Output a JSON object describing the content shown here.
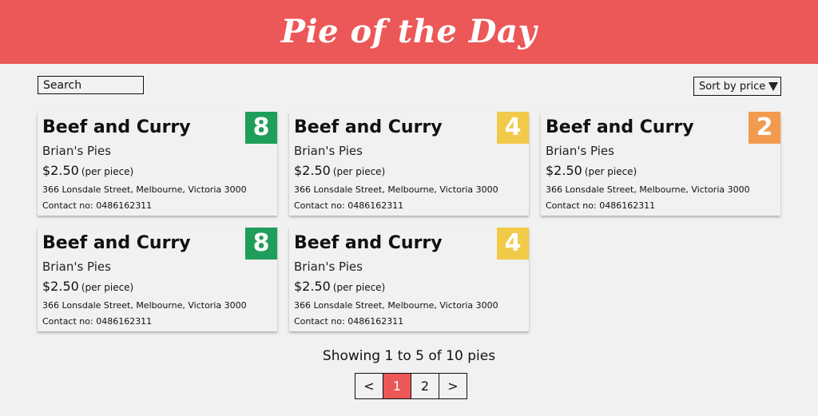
{
  "header": {
    "title": "Pie of the Day"
  },
  "search": {
    "placeholder": "Search"
  },
  "sort": {
    "label": "Sort by price"
  },
  "pies": [
    {
      "name": "Beef and Curry",
      "shop": "Brian's Pies",
      "price": "$2.50",
      "unit": "(per piece)",
      "address": "366 Lonsdale Street, Melbourne, Victoria 3000",
      "contact": "Contact no: 0486162311",
      "rating": "8",
      "rating_color": "#1e9e5a"
    },
    {
      "name": "Beef and Curry",
      "shop": "Brian's Pies",
      "price": "$2.50",
      "unit": "(per piece)",
      "address": "366 Lonsdale Street, Melbourne, Victoria 3000",
      "contact": "Contact no: 0486162311",
      "rating": "4",
      "rating_color": "#f2ca4a"
    },
    {
      "name": "Beef and Curry",
      "shop": "Brian's Pies",
      "price": "$2.50",
      "unit": "(per piece)",
      "address": "366 Lonsdale Street, Melbourne, Victoria 3000",
      "contact": "Contact no: 0486162311",
      "rating": "2",
      "rating_color": "#f29b4e"
    },
    {
      "name": "Beef and Curry",
      "shop": "Brian's Pies",
      "price": "$2.50",
      "unit": "(per piece)",
      "address": "366 Lonsdale Street, Melbourne, Victoria 3000",
      "contact": "Contact no: 0486162311",
      "rating": "8",
      "rating_color": "#1e9e5a"
    },
    {
      "name": "Beef and Curry",
      "shop": "Brian's Pies",
      "price": "$2.50",
      "unit": "(per piece)",
      "address": "366 Lonsdale Street, Melbourne, Victoria 3000",
      "contact": "Contact no: 0486162311",
      "rating": "4",
      "rating_color": "#f2ca4a"
    }
  ],
  "status": {
    "showing": "Showing 1 to 5 of 10 pies"
  },
  "pagination": {
    "prev": "<",
    "pages": [
      "1",
      "2"
    ],
    "next": ">",
    "current": "1",
    "active_color": "#ec5757"
  }
}
